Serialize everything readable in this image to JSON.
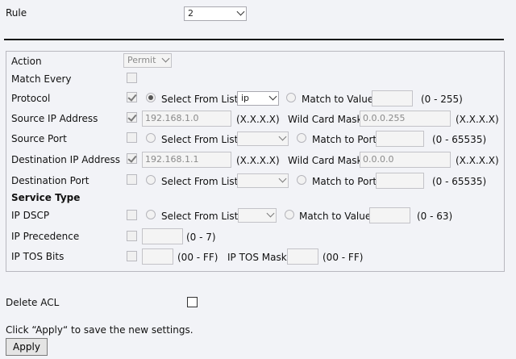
{
  "rule": {
    "label": "Rule",
    "value": "2"
  },
  "acl": {
    "action": {
      "label": "Action",
      "value": "Permit"
    },
    "match_every": {
      "label": "Match Every"
    },
    "protocol": {
      "label": "Protocol",
      "select_label": "Select From List",
      "select_value": "ip",
      "match_label": "Match to Value",
      "range": "(0 - 255)"
    },
    "source_ip": {
      "label": "Source IP Address",
      "value": "192.168.1.0",
      "format": "(X.X.X.X)",
      "mask_label": "Wild Card Mask",
      "mask_value": "0.0.0.255",
      "mask_format": "(X.X.X.X)"
    },
    "source_port": {
      "label": "Source Port",
      "select_label": "Select From List",
      "match_label": "Match to Port",
      "range": "(0 - 65535)"
    },
    "dest_ip": {
      "label": "Destination IP Address",
      "value": "192.168.1.1",
      "format": "(X.X.X.X)",
      "mask_label": "Wild Card Mask",
      "mask_value": "0.0.0.0",
      "mask_format": "(X.X.X.X)"
    },
    "dest_port": {
      "label": "Destination Port",
      "select_label": "Select From List",
      "match_label": "Match to Port",
      "range": "(0 - 65535)"
    },
    "service_type": {
      "label": "Service Type"
    },
    "ip_dscp": {
      "label": "IP DSCP",
      "select_label": "Select From List",
      "match_label": "Match to Value",
      "range": "(0 - 63)"
    },
    "ip_precedence": {
      "label": "IP Precedence",
      "range": "(0 - 7)"
    },
    "ip_tos": {
      "label": "IP TOS Bits",
      "range": "(00 - FF)",
      "mask_label": "IP TOS Mask",
      "mask_range": "(00 - FF)"
    }
  },
  "delete_acl": {
    "label": "Delete ACL"
  },
  "footer": {
    "hint": "Click “Apply“ to save the new settings.",
    "apply_label": "Apply"
  }
}
